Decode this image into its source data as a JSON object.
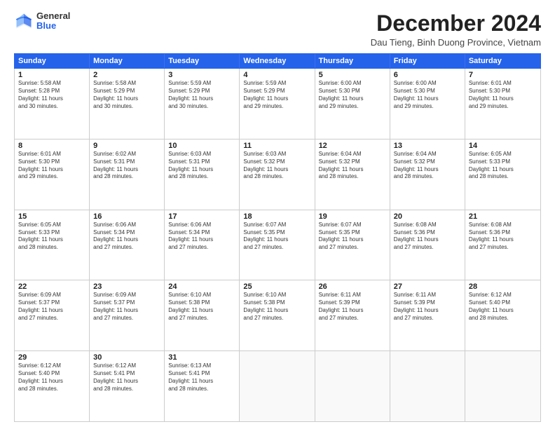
{
  "logo": {
    "general": "General",
    "blue": "Blue"
  },
  "title": "December 2024",
  "subtitle": "Dau Tieng, Binh Duong Province, Vietnam",
  "header_days": [
    "Sunday",
    "Monday",
    "Tuesday",
    "Wednesday",
    "Thursday",
    "Friday",
    "Saturday"
  ],
  "weeks": [
    [
      {
        "day": "1",
        "info": "Sunrise: 5:58 AM\nSunset: 5:28 PM\nDaylight: 11 hours\nand 30 minutes."
      },
      {
        "day": "2",
        "info": "Sunrise: 5:58 AM\nSunset: 5:29 PM\nDaylight: 11 hours\nand 30 minutes."
      },
      {
        "day": "3",
        "info": "Sunrise: 5:59 AM\nSunset: 5:29 PM\nDaylight: 11 hours\nand 30 minutes."
      },
      {
        "day": "4",
        "info": "Sunrise: 5:59 AM\nSunset: 5:29 PM\nDaylight: 11 hours\nand 29 minutes."
      },
      {
        "day": "5",
        "info": "Sunrise: 6:00 AM\nSunset: 5:30 PM\nDaylight: 11 hours\nand 29 minutes."
      },
      {
        "day": "6",
        "info": "Sunrise: 6:00 AM\nSunset: 5:30 PM\nDaylight: 11 hours\nand 29 minutes."
      },
      {
        "day": "7",
        "info": "Sunrise: 6:01 AM\nSunset: 5:30 PM\nDaylight: 11 hours\nand 29 minutes."
      }
    ],
    [
      {
        "day": "8",
        "info": "Sunrise: 6:01 AM\nSunset: 5:30 PM\nDaylight: 11 hours\nand 29 minutes."
      },
      {
        "day": "9",
        "info": "Sunrise: 6:02 AM\nSunset: 5:31 PM\nDaylight: 11 hours\nand 28 minutes."
      },
      {
        "day": "10",
        "info": "Sunrise: 6:03 AM\nSunset: 5:31 PM\nDaylight: 11 hours\nand 28 minutes."
      },
      {
        "day": "11",
        "info": "Sunrise: 6:03 AM\nSunset: 5:32 PM\nDaylight: 11 hours\nand 28 minutes."
      },
      {
        "day": "12",
        "info": "Sunrise: 6:04 AM\nSunset: 5:32 PM\nDaylight: 11 hours\nand 28 minutes."
      },
      {
        "day": "13",
        "info": "Sunrise: 6:04 AM\nSunset: 5:32 PM\nDaylight: 11 hours\nand 28 minutes."
      },
      {
        "day": "14",
        "info": "Sunrise: 6:05 AM\nSunset: 5:33 PM\nDaylight: 11 hours\nand 28 minutes."
      }
    ],
    [
      {
        "day": "15",
        "info": "Sunrise: 6:05 AM\nSunset: 5:33 PM\nDaylight: 11 hours\nand 28 minutes."
      },
      {
        "day": "16",
        "info": "Sunrise: 6:06 AM\nSunset: 5:34 PM\nDaylight: 11 hours\nand 27 minutes."
      },
      {
        "day": "17",
        "info": "Sunrise: 6:06 AM\nSunset: 5:34 PM\nDaylight: 11 hours\nand 27 minutes."
      },
      {
        "day": "18",
        "info": "Sunrise: 6:07 AM\nSunset: 5:35 PM\nDaylight: 11 hours\nand 27 minutes."
      },
      {
        "day": "19",
        "info": "Sunrise: 6:07 AM\nSunset: 5:35 PM\nDaylight: 11 hours\nand 27 minutes."
      },
      {
        "day": "20",
        "info": "Sunrise: 6:08 AM\nSunset: 5:36 PM\nDaylight: 11 hours\nand 27 minutes."
      },
      {
        "day": "21",
        "info": "Sunrise: 6:08 AM\nSunset: 5:36 PM\nDaylight: 11 hours\nand 27 minutes."
      }
    ],
    [
      {
        "day": "22",
        "info": "Sunrise: 6:09 AM\nSunset: 5:37 PM\nDaylight: 11 hours\nand 27 minutes."
      },
      {
        "day": "23",
        "info": "Sunrise: 6:09 AM\nSunset: 5:37 PM\nDaylight: 11 hours\nand 27 minutes."
      },
      {
        "day": "24",
        "info": "Sunrise: 6:10 AM\nSunset: 5:38 PM\nDaylight: 11 hours\nand 27 minutes."
      },
      {
        "day": "25",
        "info": "Sunrise: 6:10 AM\nSunset: 5:38 PM\nDaylight: 11 hours\nand 27 minutes."
      },
      {
        "day": "26",
        "info": "Sunrise: 6:11 AM\nSunset: 5:39 PM\nDaylight: 11 hours\nand 27 minutes."
      },
      {
        "day": "27",
        "info": "Sunrise: 6:11 AM\nSunset: 5:39 PM\nDaylight: 11 hours\nand 27 minutes."
      },
      {
        "day": "28",
        "info": "Sunrise: 6:12 AM\nSunset: 5:40 PM\nDaylight: 11 hours\nand 28 minutes."
      }
    ],
    [
      {
        "day": "29",
        "info": "Sunrise: 6:12 AM\nSunset: 5:40 PM\nDaylight: 11 hours\nand 28 minutes."
      },
      {
        "day": "30",
        "info": "Sunrise: 6:12 AM\nSunset: 5:41 PM\nDaylight: 11 hours\nand 28 minutes."
      },
      {
        "day": "31",
        "info": "Sunrise: 6:13 AM\nSunset: 5:41 PM\nDaylight: 11 hours\nand 28 minutes."
      },
      {
        "day": "",
        "info": ""
      },
      {
        "day": "",
        "info": ""
      },
      {
        "day": "",
        "info": ""
      },
      {
        "day": "",
        "info": ""
      }
    ]
  ]
}
